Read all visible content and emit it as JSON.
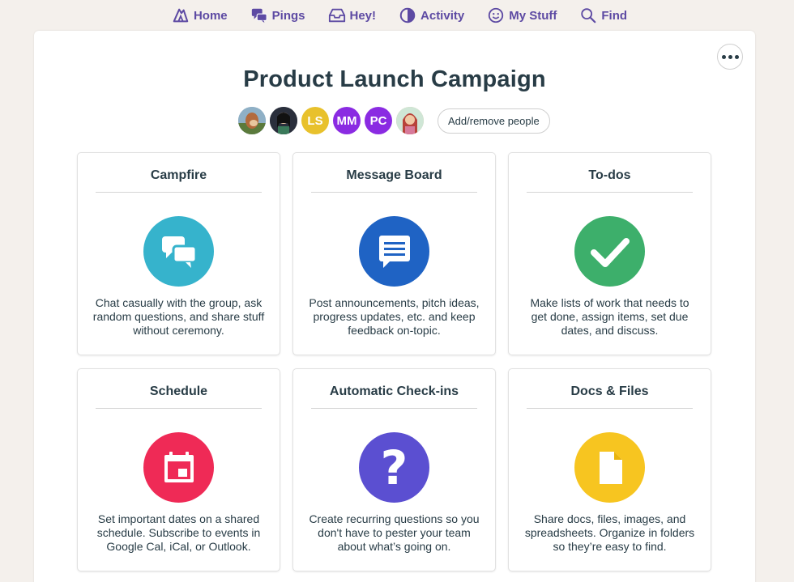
{
  "nav": {
    "items": [
      {
        "label": "Home",
        "icon": "home-icon"
      },
      {
        "label": "Pings",
        "icon": "pings-icon"
      },
      {
        "label": "Hey!",
        "icon": "inbox-icon"
      },
      {
        "label": "Activity",
        "icon": "activity-icon"
      },
      {
        "label": "My Stuff",
        "icon": "smiley-icon"
      },
      {
        "label": "Find",
        "icon": "search-icon"
      }
    ],
    "color": "#5d4aa3"
  },
  "project": {
    "title": "Product Launch Campaign",
    "more_icon": "ellipsis-icon"
  },
  "people": {
    "avatars": [
      {
        "initials": "",
        "kind": "photo",
        "color": "#7f9db5"
      },
      {
        "initials": "",
        "kind": "photo",
        "color": "#2f3a4a"
      },
      {
        "initials": "LS",
        "kind": "initials",
        "color": "#e8c12c"
      },
      {
        "initials": "MM",
        "kind": "initials",
        "color": "#8a2be2"
      },
      {
        "initials": "PC",
        "kind": "initials",
        "color": "#8a2be2"
      },
      {
        "initials": "",
        "kind": "photo",
        "color": "#d9b48a"
      }
    ],
    "add_remove_label": "Add/remove people"
  },
  "tools": [
    {
      "name": "Campfire",
      "description": "Chat casually with the group, ask random questions, and share stuff without ceremony.",
      "icon": "chat-bubbles-icon",
      "color": "#36b3cc"
    },
    {
      "name": "Message Board",
      "description": "Post announcements, pitch ideas, progress updates, etc. and keep feedback on-topic.",
      "icon": "message-icon",
      "color": "#1f63c4"
    },
    {
      "name": "To-dos",
      "description": "Make lists of work that needs to get done, assign items, set due dates, and discuss.",
      "icon": "checkmark-icon",
      "color": "#3daf6b"
    },
    {
      "name": "Schedule",
      "description": "Set important dates on a shared schedule. Subscribe to events in Google Cal, iCal, or Outlook.",
      "icon": "calendar-icon",
      "color": "#ef2a56"
    },
    {
      "name": "Automatic Check-ins",
      "description": "Create recurring questions so you don't have to pester your team about what’s going on.",
      "icon": "question-mark-icon",
      "color": "#5b4fd1"
    },
    {
      "name": "Docs & Files",
      "description": "Share docs, files, images, and spreadsheets. Organize in folders so they’re easy to find.",
      "icon": "document-icon",
      "color": "#f7c520"
    }
  ]
}
